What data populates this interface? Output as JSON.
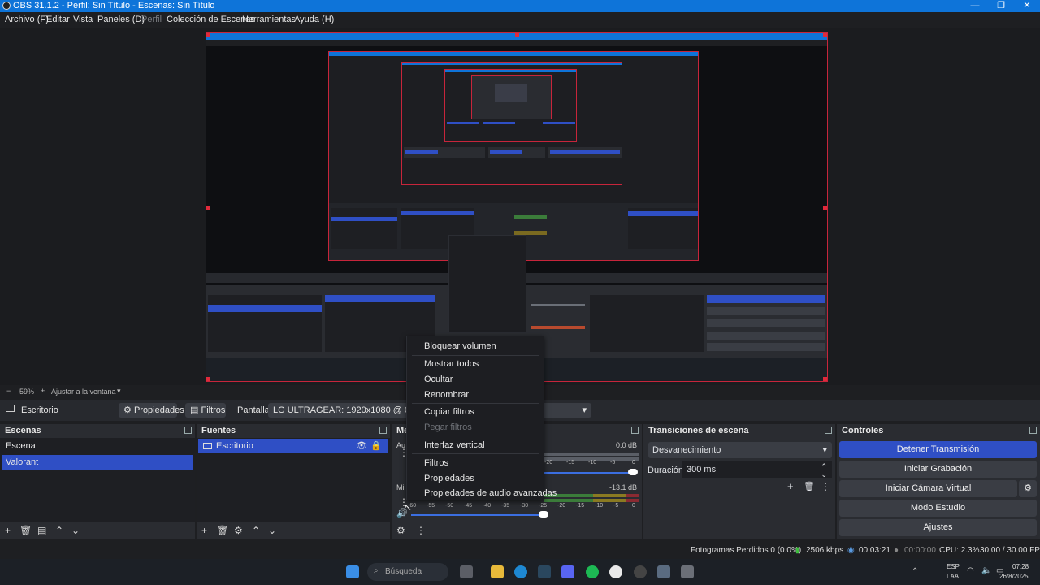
{
  "window": {
    "title": "OBS 31.1.2 - Perfil: Sin Título - Escenas: Sin Título",
    "minimize_glyph": "—",
    "maximize_glyph": "❐",
    "close_glyph": "✕"
  },
  "menubar": [
    "Archivo (F)",
    "Editar",
    "Vista",
    "Paneles (D)",
    "Perfil",
    "Colección de Escenas",
    "Herramientas",
    "Ayuda (H)"
  ],
  "zoom": {
    "minus": "−",
    "level": "59%",
    "plus": "+",
    "fit_label": "Ajustar a la ventana"
  },
  "source_toolbar": {
    "source_name": "Escritorio",
    "properties_label": "Propiedades",
    "filters_label": "Filtros",
    "display_label": "Pantalla",
    "display_value": "LG ULTRAGEAR: 1920x1080 @ 0,0 (Monitor"
  },
  "scenes": {
    "title": "Escenas",
    "items": [
      "Escena",
      "Valorant"
    ],
    "selected": 1
  },
  "sources": {
    "title": "Fuentes",
    "items": [
      "Escritorio"
    ]
  },
  "mixer": {
    "title": "Me",
    "ch1_label": "Au",
    "ch1_db": "0.0 dB",
    "ch2_label": "Mi",
    "ch2_db": "-13.1 dB",
    "ticks": [
      "-60",
      "-55",
      "-50",
      "-45",
      "-40",
      "-35",
      "-30",
      "-25",
      "-20",
      "-15",
      "-10",
      "-5",
      "0"
    ]
  },
  "transitions": {
    "title": "Transiciones de escena",
    "selected": "Desvanecimiento",
    "duration_label": "Duración",
    "duration_value": "300 ms"
  },
  "controls": {
    "title": "Controles",
    "buttons": [
      "Detener Transmisión",
      "Iniciar Grabación",
      "Iniciar Cámara Virtual",
      "Modo Estudio",
      "Ajustes"
    ]
  },
  "context_menu": {
    "items": [
      "Bloquear volumen",
      "Mostrar todos",
      "Ocultar",
      "Renombrar",
      "Copiar filtros",
      "Pegar filtros",
      "Interfaz vertical",
      "Filtros",
      "Propiedades",
      "Propiedades de audio avanzadas"
    ],
    "disabled": [
      "Pegar filtros"
    ]
  },
  "status": {
    "dropped": "Fotogramas Perdidos 0 (0.0%)",
    "bitrate": "2506 kbps",
    "stream_time": "00:03:21",
    "rec_time": "00:00:00",
    "cpu": "CPU: 2.3%",
    "fps": "30.00 / 30.00 FPS"
  },
  "taskbar": {
    "search_placeholder": "Búsqueda",
    "lang_top": "ESP",
    "lang_bottom": "LAA",
    "time": "07:28",
    "date": "26/8/2025"
  },
  "colors": {
    "accent": "#2f4fc5",
    "title_bar": "#0e74d9",
    "selection_border": "#c7253b"
  }
}
